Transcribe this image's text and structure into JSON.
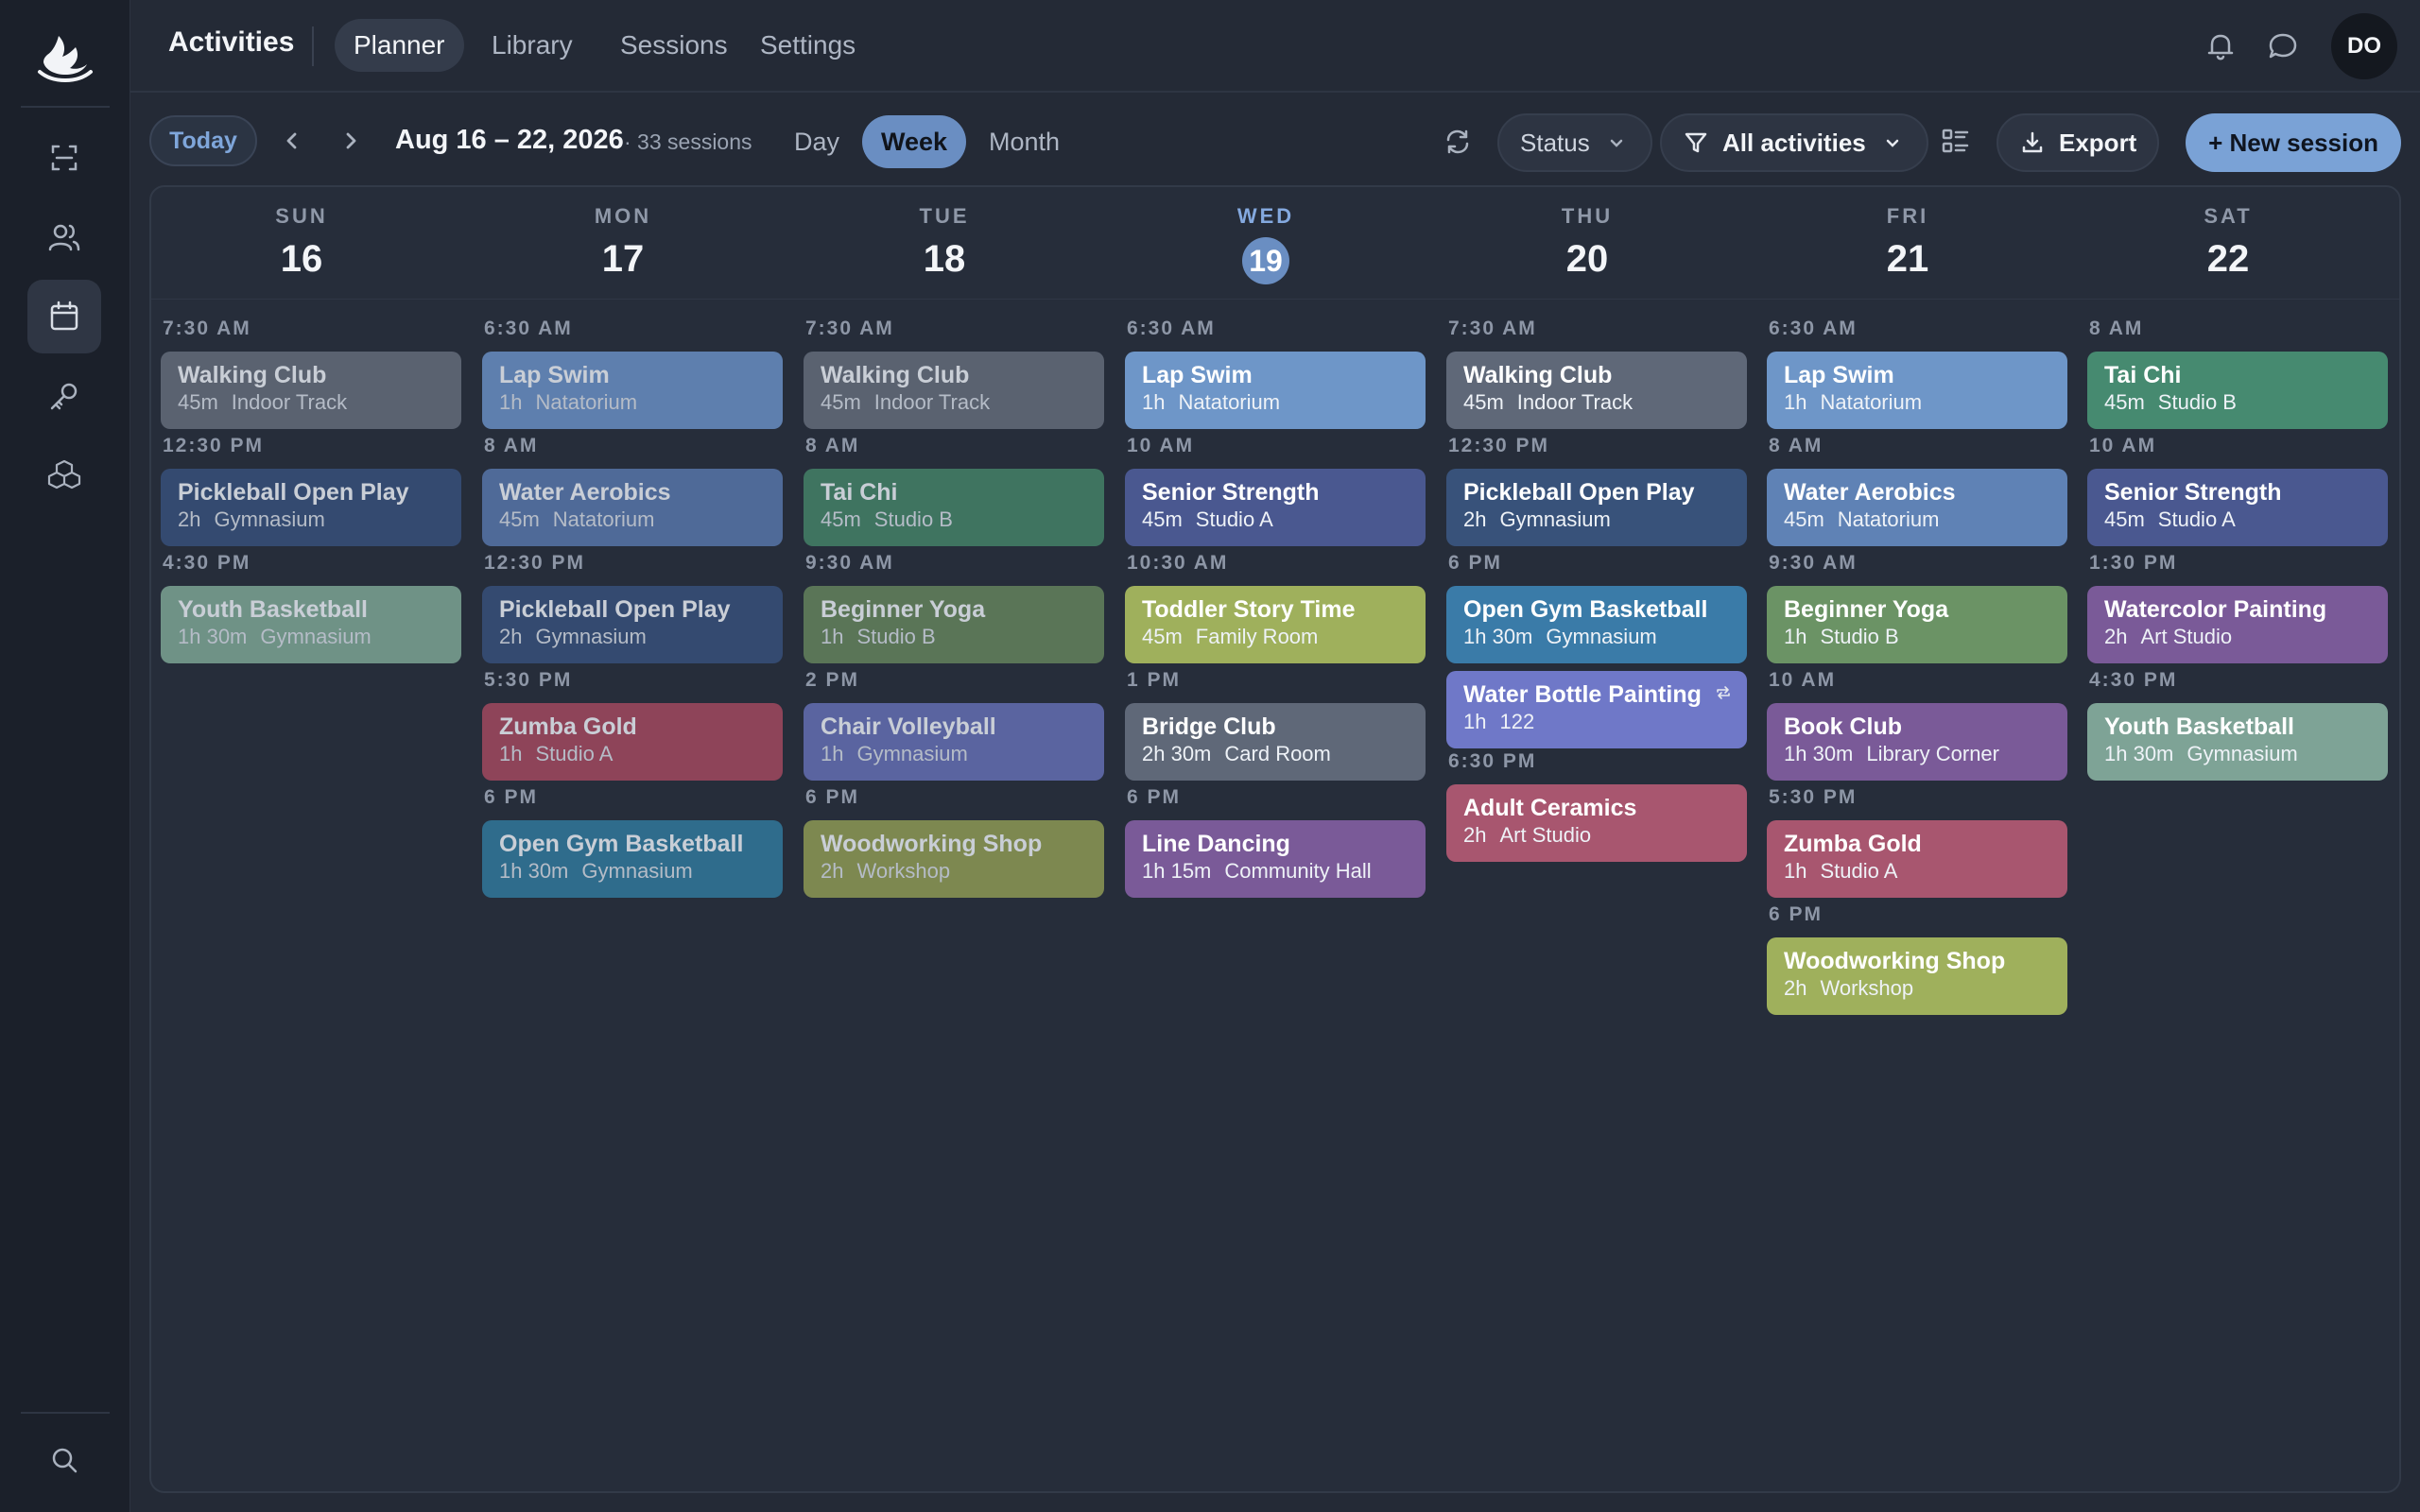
{
  "header": {
    "app_title": "Activities",
    "tabs": [
      "Planner",
      "Library",
      "Sessions",
      "Settings"
    ],
    "active_tab": "Planner",
    "avatar_initials": "DO"
  },
  "toolbar": {
    "today_label": "Today",
    "date_range": "Aug 16 – 22, 2026",
    "session_count": "· 33 sessions",
    "views": [
      "Day",
      "Week",
      "Month"
    ],
    "active_view": "Week",
    "status_filter": "Status",
    "activity_filter": "All activities",
    "export_label": "Export",
    "new_session_label": "+ New session"
  },
  "icons": {
    "rail": [
      "app-logo",
      "scan-icon",
      "users-icon",
      "calendar-icon",
      "key-icon",
      "boxes-icon",
      "search-icon"
    ],
    "top": [
      "bell-icon",
      "chat-icon"
    ],
    "toolbar": [
      "chevron-left-icon",
      "chevron-right-icon",
      "refresh-icon",
      "chevron-down-icon",
      "filter-icon",
      "layout-icon",
      "download-icon"
    ]
  },
  "colors": {
    "accent": "#7aa2d6",
    "slate": "#5a6270",
    "blue": "#6e96c8",
    "navy": "#344a70",
    "sage": "#7ea396",
    "red": "#99495e",
    "teal": "#2f6c8c",
    "green": "#3f7460",
    "olive": "#5a7557",
    "periwinkle": "#5a64a0",
    "mustard": "#8b9658",
    "gray": "#5f6878",
    "purple": "#7a5a98",
    "indigo": "#4a5890",
    "lime": "#9fb05c",
    "rose": "#a8566f",
    "lavender": "#6f78c8"
  },
  "days": [
    {
      "dow": "SUN",
      "dom": "16",
      "today": false,
      "events": [
        {
          "time": "7:30 AM",
          "title": "Walking Club",
          "duration": "45m",
          "location": "Indoor Track",
          "color": "#5a6270",
          "tone": "dim"
        },
        {
          "time": "12:30 PM",
          "title": "Pickleball Open Play",
          "duration": "2h",
          "location": "Gymnasium",
          "color": "#344a70",
          "tone": "dim"
        },
        {
          "time": "4:30 PM",
          "title": "Youth Basketball",
          "duration": "1h 30m",
          "location": "Gymnasium",
          "color": "#6f9286",
          "tone": "dim"
        }
      ]
    },
    {
      "dow": "MON",
      "dom": "17",
      "today": false,
      "events": [
        {
          "time": "6:30 AM",
          "title": "Lap Swim",
          "duration": "1h",
          "location": "Natatorium",
          "color": "#5e7fae",
          "tone": "dim"
        },
        {
          "time": "8 AM",
          "title": "Water Aerobics",
          "duration": "45m",
          "location": "Natatorium",
          "color": "#4f6a98",
          "tone": "dim"
        },
        {
          "time": "12:30 PM",
          "title": "Pickleball Open Play",
          "duration": "2h",
          "location": "Gymnasium",
          "color": "#344a70",
          "tone": "dim"
        },
        {
          "time": "5:30 PM",
          "title": "Zumba Gold",
          "duration": "1h",
          "location": "Studio A",
          "color": "#8e4459",
          "tone": "dim"
        },
        {
          "time": "6 PM",
          "title": "Open Gym Basketball",
          "duration": "1h 30m",
          "location": "Gymnasium",
          "color": "#2f6c8c",
          "tone": "dim"
        }
      ]
    },
    {
      "dow": "TUE",
      "dom": "18",
      "today": false,
      "events": [
        {
          "time": "7:30 AM",
          "title": "Walking Club",
          "duration": "45m",
          "location": "Indoor Track",
          "color": "#5a6270",
          "tone": "dim"
        },
        {
          "time": "8 AM",
          "title": "Tai Chi",
          "duration": "45m",
          "location": "Studio B",
          "color": "#3f7460",
          "tone": "dim"
        },
        {
          "time": "9:30 AM",
          "title": "Beginner Yoga",
          "duration": "1h",
          "location": "Studio B",
          "color": "#5a7557",
          "tone": "dim"
        },
        {
          "time": "2 PM",
          "title": "Chair Volleyball",
          "duration": "1h",
          "location": "Gymnasium",
          "color": "#5a64a0",
          "tone": "dim"
        },
        {
          "time": "6 PM",
          "title": "Woodworking Shop",
          "duration": "2h",
          "location": "Workshop",
          "color": "#7d8850",
          "tone": "dim"
        }
      ]
    },
    {
      "dow": "WED",
      "dom": "19",
      "today": true,
      "events": [
        {
          "time": "6:30 AM",
          "title": "Lap Swim",
          "duration": "1h",
          "location": "Natatorium",
          "color": "#6e96c8",
          "tone": "bright"
        },
        {
          "time": "10 AM",
          "title": "Senior Strength",
          "duration": "45m",
          "location": "Studio A",
          "color": "#4a5890",
          "tone": "bright"
        },
        {
          "time": "10:30 AM",
          "title": "Toddler Story Time",
          "duration": "45m",
          "location": "Family Room",
          "color": "#9fb05c",
          "tone": "bright"
        },
        {
          "time": "1 PM",
          "title": "Bridge Club",
          "duration": "2h 30m",
          "location": "Card Room",
          "color": "#5f6878",
          "tone": "bright"
        },
        {
          "time": "6 PM",
          "title": "Line Dancing",
          "duration": "1h 15m",
          "location": "Community Hall",
          "color": "#7a5a98",
          "tone": "bright"
        }
      ]
    },
    {
      "dow": "THU",
      "dom": "20",
      "today": false,
      "events": [
        {
          "time": "7:30 AM",
          "title": "Walking Club",
          "duration": "45m",
          "location": "Indoor Track",
          "color": "#5f6878",
          "tone": "bright"
        },
        {
          "time": "12:30 PM",
          "title": "Pickleball Open Play",
          "duration": "2h",
          "location": "Gymnasium",
          "color": "#38527a",
          "tone": "bright"
        },
        {
          "time": "6 PM",
          "title": "Open Gym Basketball",
          "duration": "1h 30m",
          "location": "Gymnasium",
          "color": "#3a7ba8",
          "tone": "bright"
        },
        {
          "time": "",
          "title": "Water Bottle Painting",
          "duration": "1h",
          "location": "122",
          "color": "#6f78c8",
          "tone": "bright",
          "repeat": true
        },
        {
          "time": "6:30 PM",
          "title": "Adult Ceramics",
          "duration": "2h",
          "location": "Art Studio",
          "color": "#a8566f",
          "tone": "bright"
        }
      ]
    },
    {
      "dow": "FRI",
      "dom": "21",
      "today": false,
      "events": [
        {
          "time": "6:30 AM",
          "title": "Lap Swim",
          "duration": "1h",
          "location": "Natatorium",
          "color": "#6e96c8",
          "tone": "bright"
        },
        {
          "time": "8 AM",
          "title": "Water Aerobics",
          "duration": "45m",
          "location": "Natatorium",
          "color": "#5f82b5",
          "tone": "bright"
        },
        {
          "time": "9:30 AM",
          "title": "Beginner Yoga",
          "duration": "1h",
          "location": "Studio B",
          "color": "#6b9365",
          "tone": "bright"
        },
        {
          "time": "10 AM",
          "title": "Book Club",
          "duration": "1h 30m",
          "location": "Library Corner",
          "color": "#7a5a98",
          "tone": "bright"
        },
        {
          "time": "5:30 PM",
          "title": "Zumba Gold",
          "duration": "1h",
          "location": "Studio A",
          "color": "#a8566f",
          "tone": "bright"
        },
        {
          "time": "6 PM",
          "title": "Woodworking Shop",
          "duration": "2h",
          "location": "Workshop",
          "color": "#9fb05c",
          "tone": "bright"
        }
      ]
    },
    {
      "dow": "SAT",
      "dom": "22",
      "today": false,
      "events": [
        {
          "time": "8 AM",
          "title": "Tai Chi",
          "duration": "45m",
          "location": "Studio B",
          "color": "#468a70",
          "tone": "bright"
        },
        {
          "time": "10 AM",
          "title": "Senior Strength",
          "duration": "45m",
          "location": "Studio A",
          "color": "#4a5890",
          "tone": "bright"
        },
        {
          "time": "1:30 PM",
          "title": "Watercolor Painting",
          "duration": "2h",
          "location": "Art Studio",
          "color": "#7a5a98",
          "tone": "bright"
        },
        {
          "time": "4:30 PM",
          "title": "Youth Basketball",
          "duration": "1h 30m",
          "location": "Gymnasium",
          "color": "#7ea396",
          "tone": "bright"
        }
      ]
    }
  ]
}
